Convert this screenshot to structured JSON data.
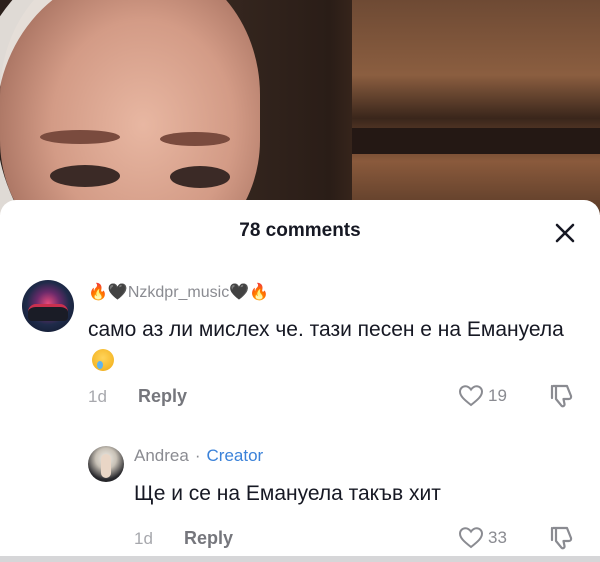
{
  "header": {
    "comments_count": "78 comments"
  },
  "comments": [
    {
      "username": "🔥🖤Nzkdpr_music🖤🔥",
      "text": "само аз ли мислех че. тази песен е на Емануела",
      "age": "1d",
      "reply_label": "Reply",
      "likes": "19"
    },
    {
      "username": "Andrea",
      "separator": "·",
      "badge": "Creator",
      "text": "Ще и се на Емануела такъв хит",
      "age": "1d",
      "reply_label": "Reply",
      "likes": "33"
    }
  ],
  "colors": {
    "creator_badge": "#3b82d9",
    "meta_gray": "#8a8b91",
    "text": "#161823"
  },
  "icons": {
    "close": "close-icon",
    "like": "heart-outline-icon",
    "dislike": "thumbs-down-icon",
    "emoji": "crying-face-emoji"
  }
}
